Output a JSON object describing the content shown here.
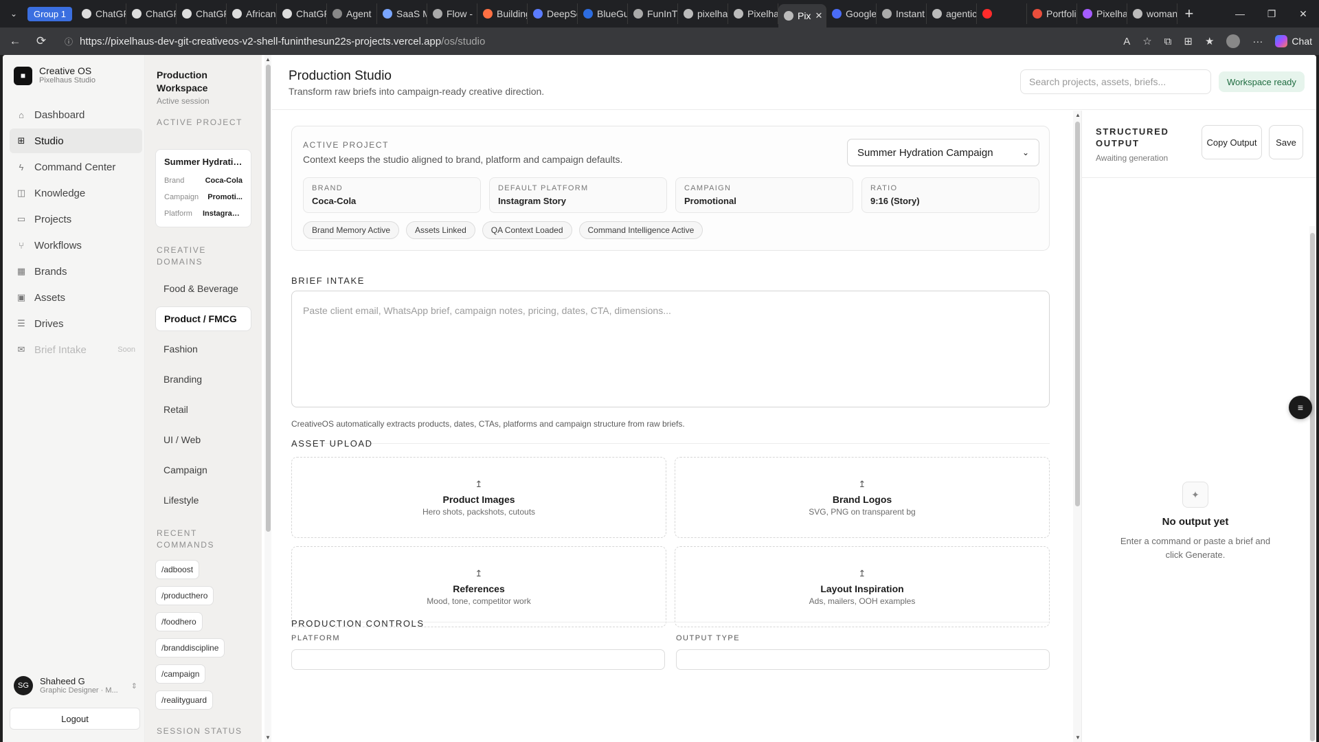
{
  "browser": {
    "group_label": "Group 1",
    "tabs": [
      {
        "label": "ChatGPT"
      },
      {
        "label": "ChatGPT"
      },
      {
        "label": "ChatGPT"
      },
      {
        "label": "African"
      },
      {
        "label": "ChatGPT"
      },
      {
        "label": "Agent"
      },
      {
        "label": "SaaS M"
      },
      {
        "label": "Flow -"
      },
      {
        "label": "Building"
      },
      {
        "label": "DeepSe"
      },
      {
        "label": "BlueGu"
      },
      {
        "label": "FunInT"
      },
      {
        "label": "pixelha"
      },
      {
        "label": "Pixelha"
      },
      {
        "label": "Pix"
      },
      {
        "label": "Google"
      },
      {
        "label": "Instant"
      },
      {
        "label": "agentic"
      },
      {
        "label": ""
      },
      {
        "label": "Portfoli"
      },
      {
        "label": "Pixelha"
      },
      {
        "label": "woman"
      }
    ],
    "url_main": "https://pixelhaus-dev-git-creativeos-v2-shell-funinthesun22s-projects.vercel.app",
    "url_path": "/os/studio",
    "chat_label": "Chat"
  },
  "sidebar": {
    "app_name": "Creative OS",
    "app_sub": "Pixelhaus Studio",
    "items": [
      {
        "label": "Dashboard",
        "icon": "home-icon"
      },
      {
        "label": "Studio",
        "icon": "plus-square-icon"
      },
      {
        "label": "Command Center",
        "icon": "bolt-icon"
      },
      {
        "label": "Knowledge",
        "icon": "book-icon"
      },
      {
        "label": "Projects",
        "icon": "folder-icon"
      },
      {
        "label": "Workflows",
        "icon": "workflow-icon"
      },
      {
        "label": "Brands",
        "icon": "grid-icon"
      },
      {
        "label": "Assets",
        "icon": "image-icon"
      },
      {
        "label": "Drives",
        "icon": "database-icon"
      },
      {
        "label": "Brief Intake",
        "icon": "inbox-icon",
        "soon": "Soon"
      }
    ],
    "user_initials": "SG",
    "user_name": "Shaheed G",
    "user_role": "Graphic Designer · M...",
    "logout_label": "Logout"
  },
  "workspace": {
    "title": "Production Workspace",
    "sub": "Active session",
    "active_project_label": "ACTIVE PROJECT",
    "active_card": {
      "title": "Summer Hydratio...",
      "rows": [
        {
          "k": "Brand",
          "v": "Coca-Cola"
        },
        {
          "k": "Campaign",
          "v": "Promoti..."
        },
        {
          "k": "Platform",
          "v": "Instagram..."
        }
      ]
    },
    "domains_label": "CREATIVE DOMAINS",
    "domains": [
      "Food & Beverage",
      "Product / FMCG",
      "Fashion",
      "Branding",
      "Retail",
      "UI / Web",
      "Campaign",
      "Lifestyle"
    ],
    "commands_label": "RECENT COMMANDS",
    "commands": [
      "/adboost",
      "/producthero",
      "/foodhero",
      "/branddiscipline",
      "/campaign",
      "/realityguard"
    ],
    "session_label": "SESSION STATUS"
  },
  "header": {
    "title": "Production Studio",
    "sub": "Transform raw briefs into campaign-ready creative direction.",
    "search_placeholder": "Search projects, assets, briefs...",
    "status": "Workspace ready"
  },
  "active_project": {
    "label": "ACTIVE PROJECT",
    "sub": "Context keeps the studio aligned to brand, platform and campaign defaults.",
    "selected": "Summer Hydration Campaign",
    "fields": [
      {
        "k": "BRAND",
        "v": "Coca-Cola"
      },
      {
        "k": "DEFAULT PLATFORM",
        "v": "Instagram Story"
      },
      {
        "k": "CAMPAIGN",
        "v": "Promotional"
      },
      {
        "k": "RATIO",
        "v": "9:16 (Story)"
      }
    ],
    "chips": [
      "Brand Memory Active",
      "Assets Linked",
      "QA Context Loaded",
      "Command Intelligence Active"
    ]
  },
  "brief": {
    "label": "BRIEF INTAKE",
    "placeholder": "Paste client email, WhatsApp brief, campaign notes, pricing, dates, CTA, dimensions...",
    "helper": "CreativeOS automatically extracts products, dates, CTAs, platforms and campaign structure from raw briefs."
  },
  "upload": {
    "label": "ASSET UPLOAD",
    "tiles": [
      {
        "title": "Product Images",
        "sub": "Hero shots, packshots, cutouts"
      },
      {
        "title": "Brand Logos",
        "sub": "SVG, PNG on transparent bg"
      },
      {
        "title": "References",
        "sub": "Mood, tone, competitor work"
      },
      {
        "title": "Layout Inspiration",
        "sub": "Ads, mailers, OOH examples"
      }
    ]
  },
  "controls": {
    "label": "PRODUCTION CONTROLS",
    "platform_label": "PLATFORM",
    "output_type_label": "OUTPUT TYPE"
  },
  "output": {
    "title": "STRUCTURED OUTPUT",
    "sub": "Awaiting generation",
    "copy_label": "Copy Output",
    "save_label": "Save",
    "empty_title": "No output yet",
    "empty_sub": "Enter a command or paste a brief and click Generate."
  }
}
